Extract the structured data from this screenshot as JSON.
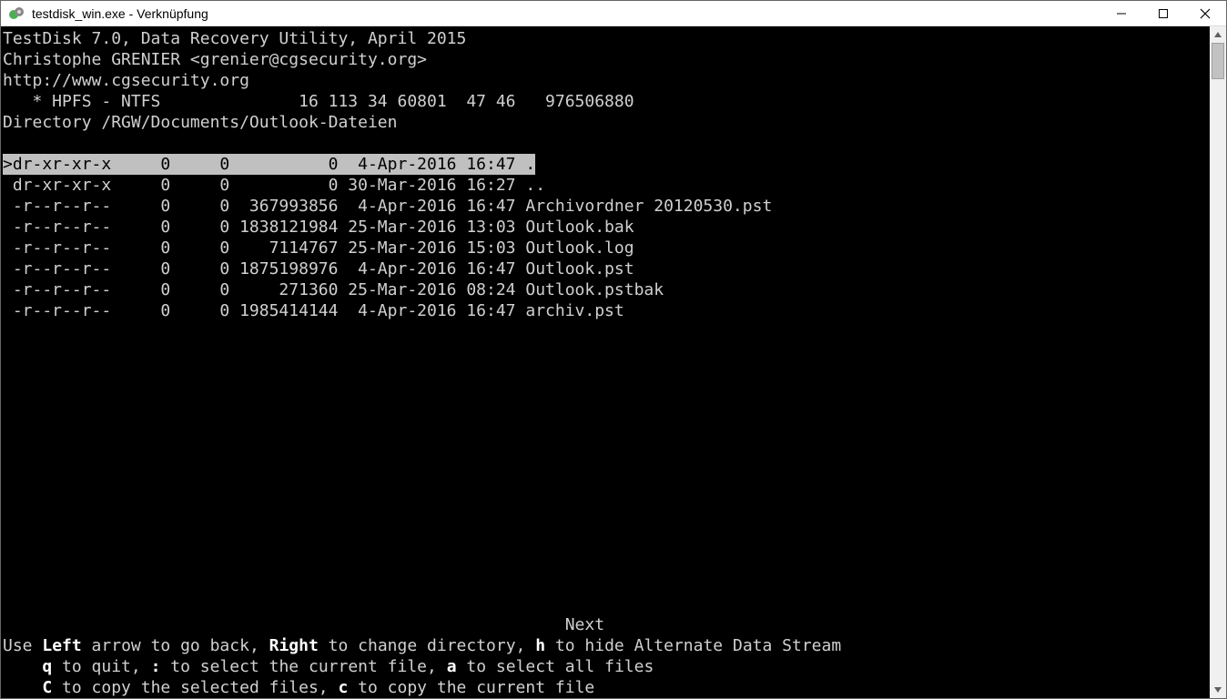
{
  "window": {
    "title": "testdisk_win.exe - Verknüpfung"
  },
  "header": {
    "line1": "TestDisk 7.0, Data Recovery Utility, April 2015",
    "line2": "Christophe GRENIER <grenier@cgsecurity.org>",
    "line3": "http://www.cgsecurity.org",
    "partition": "   * HPFS - NTFS              16 113 34 60801  47 46   976506880",
    "directory_label": "Directory ",
    "directory_path": "/RGW/Documents/Outlook-Dateien"
  },
  "files": [
    {
      "selected": true,
      "perm": "dr-xr-xr-x",
      "uid": "0",
      "gid": "0",
      "size": "0",
      "date": " 4-Apr-2016 16:47",
      "name": "."
    },
    {
      "selected": false,
      "perm": "dr-xr-xr-x",
      "uid": "0",
      "gid": "0",
      "size": "0",
      "date": "30-Mar-2016 16:27",
      "name": ".."
    },
    {
      "selected": false,
      "perm": "-r--r--r--",
      "uid": "0",
      "gid": "0",
      "size": "367993856",
      "date": " 4-Apr-2016 16:47",
      "name": "Archivordner 20120530.pst"
    },
    {
      "selected": false,
      "perm": "-r--r--r--",
      "uid": "0",
      "gid": "0",
      "size": "1838121984",
      "date": "25-Mar-2016 13:03",
      "name": "Outlook.bak"
    },
    {
      "selected": false,
      "perm": "-r--r--r--",
      "uid": "0",
      "gid": "0",
      "size": "7114767",
      "date": "25-Mar-2016 15:03",
      "name": "Outlook.log"
    },
    {
      "selected": false,
      "perm": "-r--r--r--",
      "uid": "0",
      "gid": "0",
      "size": "1875198976",
      "date": " 4-Apr-2016 16:47",
      "name": "Outlook.pst"
    },
    {
      "selected": false,
      "perm": "-r--r--r--",
      "uid": "0",
      "gid": "0",
      "size": "271360",
      "date": "25-Mar-2016 08:24",
      "name": "Outlook.pstbak"
    },
    {
      "selected": false,
      "perm": "-r--r--r--",
      "uid": "0",
      "gid": "0",
      "size": "1985414144",
      "date": " 4-Apr-2016 16:47",
      "name": "archiv.pst"
    }
  ],
  "footer": {
    "next": "Next",
    "l1_pre": "Use ",
    "l1_k1": "Left",
    "l1_m1": " arrow to go back, ",
    "l1_k2": "Right",
    "l1_m2": " to change directory, ",
    "l1_k3": "h",
    "l1_m3": " to hide Alternate Data Stream",
    "l2_pre": "    ",
    "l2_k1": "q",
    "l2_m1": " to quit, ",
    "l2_k2": ":",
    "l2_m2": " to select the current file, ",
    "l2_k3": "a",
    "l2_m3": " to select all files",
    "l3_pre": "    ",
    "l3_k1": "C",
    "l3_m1": " to copy the selected files, ",
    "l3_k2": "c",
    "l3_m2": " to copy the current file"
  }
}
